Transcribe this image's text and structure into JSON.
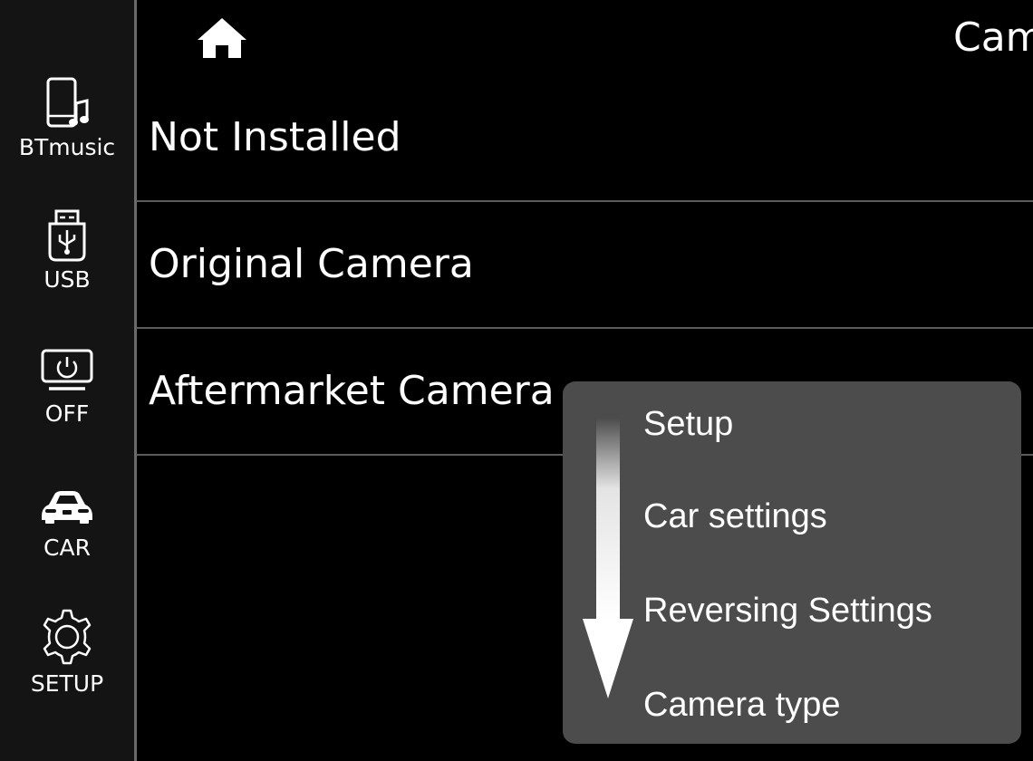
{
  "sidebar": {
    "items": [
      {
        "label": "BTmusic",
        "icon": "phone-music-icon"
      },
      {
        "label": "USB",
        "icon": "usb-icon"
      },
      {
        "label": "OFF",
        "icon": "screen-power-icon"
      },
      {
        "label": "CAR",
        "icon": "car-icon"
      },
      {
        "label": "SETUP",
        "icon": "gear-icon"
      }
    ]
  },
  "header": {
    "title": "Cam",
    "home_icon": "home-icon"
  },
  "options": [
    {
      "label": "Not Installed"
    },
    {
      "label": "Original Camera"
    },
    {
      "label": "Aftermarket Camera"
    }
  ],
  "hint": {
    "arrow_icon": "down-arrow-icon",
    "steps": [
      {
        "label": "Setup"
      },
      {
        "label": "Car settings"
      },
      {
        "label": "Reversing Settings"
      },
      {
        "label": "Camera type"
      }
    ]
  },
  "colors": {
    "background": "#000000",
    "sidebar": "#141414",
    "divider": "#5c5c5c",
    "panel": "#4c4c4c",
    "text": "#ffffff"
  }
}
